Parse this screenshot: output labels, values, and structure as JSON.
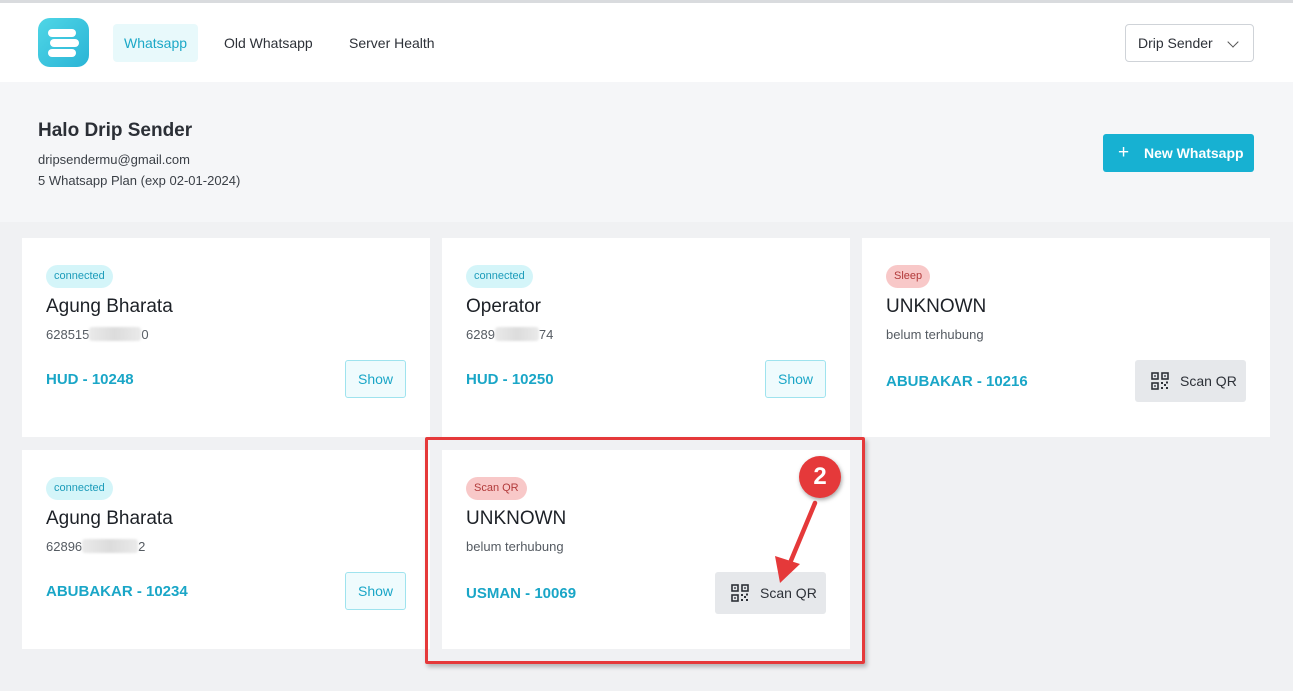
{
  "nav": {
    "links": [
      "Whatsapp",
      "Old Whatsapp",
      "Server Health"
    ],
    "account_dropdown": "Drip Sender"
  },
  "header": {
    "greeting": "Halo Drip Sender",
    "email": "dripsendermu@gmail.com",
    "plan": "5 Whatsapp Plan (exp 02-01-2024)",
    "new_button": "New Whatsapp"
  },
  "devices": [
    {
      "status": "connected",
      "name": "Agung Bharata",
      "number_start": "628515",
      "number_end": "0",
      "project": "HUD - 10248",
      "action": "Show"
    },
    {
      "status": "connected",
      "name": "Operator",
      "number_start": "6289",
      "number_end": "74",
      "project": "HUD - 10250",
      "action": "Show"
    },
    {
      "status": "Sleep",
      "name": "UNKNOWN",
      "number_text": "belum terhubung",
      "project": "ABUBAKAR - 10216",
      "action": "Scan QR"
    },
    {
      "status": "connected",
      "name": "Agung Bharata",
      "number_start": "62896",
      "number_end": "2",
      "project": "ABUBAKAR - 10234",
      "action": "Show"
    },
    {
      "status": "Scan QR",
      "name": "UNKNOWN",
      "number_text": "belum terhubung",
      "project": "USMAN - 10069",
      "action": "Scan QR"
    }
  ],
  "annotation": {
    "step_number": "2",
    "color": "#e5393a"
  },
  "colors": {
    "accent": "#17b1d2",
    "danger": "#e5393a"
  },
  "icons": [
    "logo-icon",
    "chevron-down-icon",
    "plus-icon",
    "qr-code-icon",
    "arrow-icon"
  ]
}
